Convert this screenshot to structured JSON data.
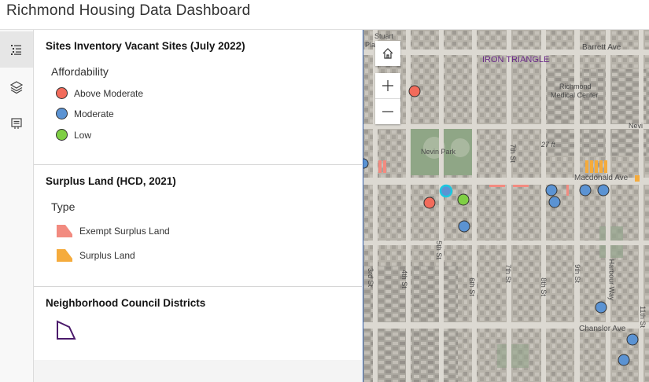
{
  "app": {
    "title": "Richmond Housing Data Dashboard"
  },
  "rail": {
    "legend_icon": "legend-list-icon",
    "layers_icon": "layers-icon",
    "info_icon": "info-panel-icon"
  },
  "legend": {
    "sites": {
      "title": "Sites Inventory Vacant Sites (July 2022)",
      "field": "Affordability",
      "items": [
        {
          "label": "Above Moderate",
          "color": "#f26b5b"
        },
        {
          "label": "Moderate",
          "color": "#5b93d3"
        },
        {
          "label": "Low",
          "color": "#7fcf44"
        }
      ]
    },
    "surplus": {
      "title": "Surplus Land (HCD, 2021)",
      "field": "Type",
      "items": [
        {
          "label": "Exempt Surplus Land",
          "color": "#f28b80"
        },
        {
          "label": "Surplus Land",
          "color": "#f5ab3c"
        }
      ]
    },
    "districts": {
      "title": "Neighborhood Council Districts",
      "color": "#4b1a6b"
    }
  },
  "map": {
    "labels": {
      "stuart": "Stuart",
      "pla": "Pla",
      "iron_triangle": "IRON TRIANGLE",
      "barrett": "Barrett Ave",
      "richmond_med_1": "Richmond",
      "richmond_med_2": "Medical Center",
      "nevin_short": "Nevi",
      "nevin_park": "Nevin Park",
      "elev": "27 ft",
      "macdonald": "Macdonald Ave",
      "chanslor": "Chanslor Ave",
      "st_3": "3rd St",
      "st_4": "4th St",
      "st_5": "5th St",
      "st_6": "6th St",
      "st_7a": "7th St",
      "st_7b": "7th St",
      "st_8": "8th St",
      "st_9": "9th St",
      "harbour": "Harbour Way",
      "st_11": "11th St"
    },
    "controls": {
      "home": "home-icon",
      "zoom_in": "plus-icon",
      "zoom_out": "minus-icon"
    }
  }
}
